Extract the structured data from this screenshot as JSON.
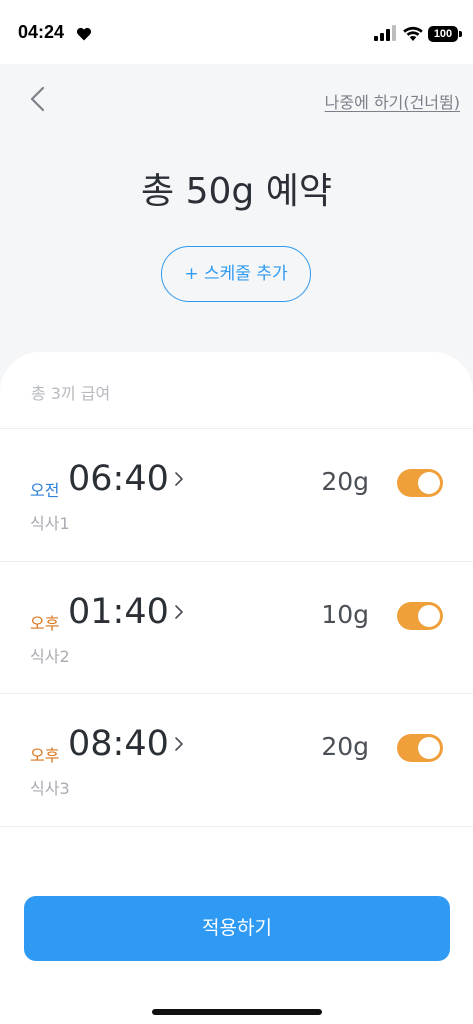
{
  "status_bar": {
    "time": "04:24",
    "battery": "100"
  },
  "header": {
    "skip_label": "나중에 하기(건너뜀)",
    "title": "총 50g 예약",
    "add_schedule_label": "+ 스케줄 추가"
  },
  "schedule": {
    "summary": "총 3끼 급여",
    "items": [
      {
        "period": "오전",
        "time": "06:40",
        "meal": "식사1",
        "amount": "20g",
        "enabled": true
      },
      {
        "period": "오후",
        "time": "01:40",
        "meal": "식사2",
        "amount": "10g",
        "enabled": true
      },
      {
        "period": "오후",
        "time": "08:40",
        "meal": "식사3",
        "amount": "20g",
        "enabled": true
      }
    ]
  },
  "footer": {
    "apply_label": "적용하기"
  },
  "colors": {
    "accent_blue": "#2e9af3",
    "toggle_on": "#f0a03b",
    "am_color": "#2f82d9",
    "pm_color": "#d9771f"
  },
  "icons": [
    "heart-icon",
    "signal-icon",
    "wifi-icon",
    "battery-icon",
    "back-arrow-icon",
    "chevron-right-icon"
  ]
}
